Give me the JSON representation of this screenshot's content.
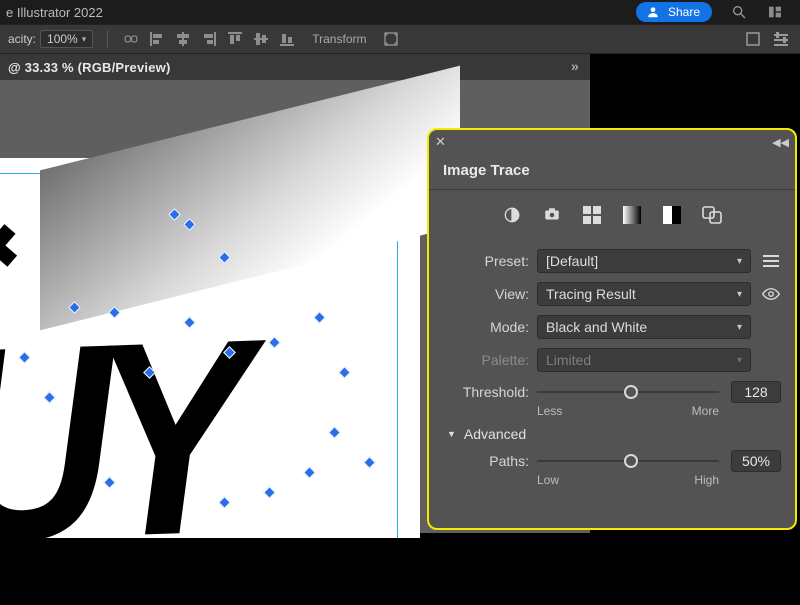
{
  "app": {
    "title": "e Illustrator 2022"
  },
  "topbar": {
    "share": "Share"
  },
  "ctrlbar": {
    "opacity_label": "acity:",
    "opacity_value": "100%",
    "transform": "Transform"
  },
  "doc": {
    "tab": " @ 33.33 % (RGB/Preview)"
  },
  "panel": {
    "title": "Image Trace",
    "preset_label": "Preset:",
    "preset_value": "[Default]",
    "view_label": "View:",
    "view_value": "Tracing Result",
    "mode_label": "Mode:",
    "mode_value": "Black and White",
    "palette_label": "Palette:",
    "palette_value": "Limited",
    "threshold_label": "Threshold:",
    "threshold_value": "128",
    "threshold_low": "Less",
    "threshold_high": "More",
    "advanced": "Advanced",
    "paths_label": "Paths:",
    "paths_value": "50%",
    "paths_low": "Low",
    "paths_high": "High"
  }
}
